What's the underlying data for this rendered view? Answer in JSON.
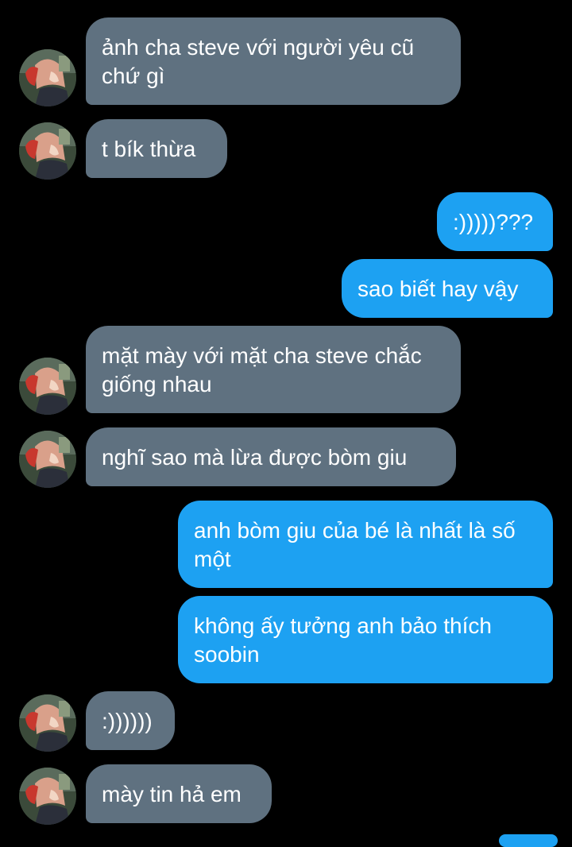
{
  "contact": {
    "avatar_icon": "anime-character-avatar"
  },
  "colors": {
    "received_bubble": "#5f7180",
    "sent_bubble": "#1da1f2",
    "background": "#000000"
  },
  "messages": [
    {
      "dir": "in",
      "text": "ảnh cha steve với người yêu cũ chứ gì"
    },
    {
      "dir": "in",
      "text": "t bík thừa"
    },
    {
      "dir": "out",
      "text": ":)))))???"
    },
    {
      "dir": "out",
      "text": "sao biết hay vậy"
    },
    {
      "dir": "in",
      "text": "mặt mày với mặt cha steve chắc giống nhau"
    },
    {
      "dir": "in",
      "text": "nghĩ sao mà lừa được bòm giu"
    },
    {
      "dir": "out",
      "text": "anh bòm giu của bé là nhất là số một"
    },
    {
      "dir": "out",
      "text": "không ấy tưởng anh bảo thích soobin"
    },
    {
      "dir": "in",
      "text": ":))))))"
    },
    {
      "dir": "in",
      "text": "mày tin hả em"
    }
  ]
}
